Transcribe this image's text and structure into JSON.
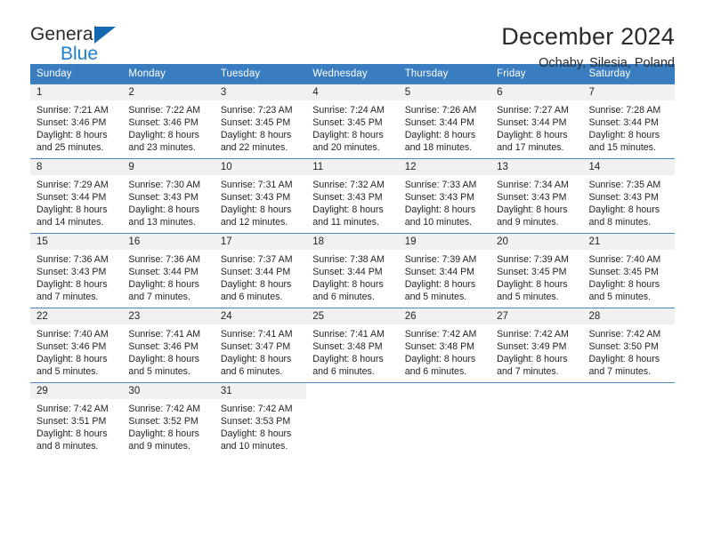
{
  "brand": {
    "name_top": "General",
    "name_bottom": "Blue",
    "accent_color": "#1c7fd0",
    "triangle_color": "#1668b0"
  },
  "header": {
    "title": "December 2024",
    "location": "Ochaby, Silesia, Poland"
  },
  "theme": {
    "header_bg": "#3a7cc0",
    "header_text": "#ffffff",
    "daynum_bg": "#f1f1f1",
    "cell_bg": "#ffffff",
    "row_border": "#4a89c4",
    "text": "#231f20"
  },
  "weekdays": [
    "Sunday",
    "Monday",
    "Tuesday",
    "Wednesday",
    "Thursday",
    "Friday",
    "Saturday"
  ],
  "weeks": [
    [
      {
        "day": "1",
        "sunrise": "Sunrise: 7:21 AM",
        "sunset": "Sunset: 3:46 PM",
        "daylight1": "Daylight: 8 hours",
        "daylight2": "and 25 minutes."
      },
      {
        "day": "2",
        "sunrise": "Sunrise: 7:22 AM",
        "sunset": "Sunset: 3:46 PM",
        "daylight1": "Daylight: 8 hours",
        "daylight2": "and 23 minutes."
      },
      {
        "day": "3",
        "sunrise": "Sunrise: 7:23 AM",
        "sunset": "Sunset: 3:45 PM",
        "daylight1": "Daylight: 8 hours",
        "daylight2": "and 22 minutes."
      },
      {
        "day": "4",
        "sunrise": "Sunrise: 7:24 AM",
        "sunset": "Sunset: 3:45 PM",
        "daylight1": "Daylight: 8 hours",
        "daylight2": "and 20 minutes."
      },
      {
        "day": "5",
        "sunrise": "Sunrise: 7:26 AM",
        "sunset": "Sunset: 3:44 PM",
        "daylight1": "Daylight: 8 hours",
        "daylight2": "and 18 minutes."
      },
      {
        "day": "6",
        "sunrise": "Sunrise: 7:27 AM",
        "sunset": "Sunset: 3:44 PM",
        "daylight1": "Daylight: 8 hours",
        "daylight2": "and 17 minutes."
      },
      {
        "day": "7",
        "sunrise": "Sunrise: 7:28 AM",
        "sunset": "Sunset: 3:44 PM",
        "daylight1": "Daylight: 8 hours",
        "daylight2": "and 15 minutes."
      }
    ],
    [
      {
        "day": "8",
        "sunrise": "Sunrise: 7:29 AM",
        "sunset": "Sunset: 3:44 PM",
        "daylight1": "Daylight: 8 hours",
        "daylight2": "and 14 minutes."
      },
      {
        "day": "9",
        "sunrise": "Sunrise: 7:30 AM",
        "sunset": "Sunset: 3:43 PM",
        "daylight1": "Daylight: 8 hours",
        "daylight2": "and 13 minutes."
      },
      {
        "day": "10",
        "sunrise": "Sunrise: 7:31 AM",
        "sunset": "Sunset: 3:43 PM",
        "daylight1": "Daylight: 8 hours",
        "daylight2": "and 12 minutes."
      },
      {
        "day": "11",
        "sunrise": "Sunrise: 7:32 AM",
        "sunset": "Sunset: 3:43 PM",
        "daylight1": "Daylight: 8 hours",
        "daylight2": "and 11 minutes."
      },
      {
        "day": "12",
        "sunrise": "Sunrise: 7:33 AM",
        "sunset": "Sunset: 3:43 PM",
        "daylight1": "Daylight: 8 hours",
        "daylight2": "and 10 minutes."
      },
      {
        "day": "13",
        "sunrise": "Sunrise: 7:34 AM",
        "sunset": "Sunset: 3:43 PM",
        "daylight1": "Daylight: 8 hours",
        "daylight2": "and 9 minutes."
      },
      {
        "day": "14",
        "sunrise": "Sunrise: 7:35 AM",
        "sunset": "Sunset: 3:43 PM",
        "daylight1": "Daylight: 8 hours",
        "daylight2": "and 8 minutes."
      }
    ],
    [
      {
        "day": "15",
        "sunrise": "Sunrise: 7:36 AM",
        "sunset": "Sunset: 3:43 PM",
        "daylight1": "Daylight: 8 hours",
        "daylight2": "and 7 minutes."
      },
      {
        "day": "16",
        "sunrise": "Sunrise: 7:36 AM",
        "sunset": "Sunset: 3:44 PM",
        "daylight1": "Daylight: 8 hours",
        "daylight2": "and 7 minutes."
      },
      {
        "day": "17",
        "sunrise": "Sunrise: 7:37 AM",
        "sunset": "Sunset: 3:44 PM",
        "daylight1": "Daylight: 8 hours",
        "daylight2": "and 6 minutes."
      },
      {
        "day": "18",
        "sunrise": "Sunrise: 7:38 AM",
        "sunset": "Sunset: 3:44 PM",
        "daylight1": "Daylight: 8 hours",
        "daylight2": "and 6 minutes."
      },
      {
        "day": "19",
        "sunrise": "Sunrise: 7:39 AM",
        "sunset": "Sunset: 3:44 PM",
        "daylight1": "Daylight: 8 hours",
        "daylight2": "and 5 minutes."
      },
      {
        "day": "20",
        "sunrise": "Sunrise: 7:39 AM",
        "sunset": "Sunset: 3:45 PM",
        "daylight1": "Daylight: 8 hours",
        "daylight2": "and 5 minutes."
      },
      {
        "day": "21",
        "sunrise": "Sunrise: 7:40 AM",
        "sunset": "Sunset: 3:45 PM",
        "daylight1": "Daylight: 8 hours",
        "daylight2": "and 5 minutes."
      }
    ],
    [
      {
        "day": "22",
        "sunrise": "Sunrise: 7:40 AM",
        "sunset": "Sunset: 3:46 PM",
        "daylight1": "Daylight: 8 hours",
        "daylight2": "and 5 minutes."
      },
      {
        "day": "23",
        "sunrise": "Sunrise: 7:41 AM",
        "sunset": "Sunset: 3:46 PM",
        "daylight1": "Daylight: 8 hours",
        "daylight2": "and 5 minutes."
      },
      {
        "day": "24",
        "sunrise": "Sunrise: 7:41 AM",
        "sunset": "Sunset: 3:47 PM",
        "daylight1": "Daylight: 8 hours",
        "daylight2": "and 6 minutes."
      },
      {
        "day": "25",
        "sunrise": "Sunrise: 7:41 AM",
        "sunset": "Sunset: 3:48 PM",
        "daylight1": "Daylight: 8 hours",
        "daylight2": "and 6 minutes."
      },
      {
        "day": "26",
        "sunrise": "Sunrise: 7:42 AM",
        "sunset": "Sunset: 3:48 PM",
        "daylight1": "Daylight: 8 hours",
        "daylight2": "and 6 minutes."
      },
      {
        "day": "27",
        "sunrise": "Sunrise: 7:42 AM",
        "sunset": "Sunset: 3:49 PM",
        "daylight1": "Daylight: 8 hours",
        "daylight2": "and 7 minutes."
      },
      {
        "day": "28",
        "sunrise": "Sunrise: 7:42 AM",
        "sunset": "Sunset: 3:50 PM",
        "daylight1": "Daylight: 8 hours",
        "daylight2": "and 7 minutes."
      }
    ],
    [
      {
        "day": "29",
        "sunrise": "Sunrise: 7:42 AM",
        "sunset": "Sunset: 3:51 PM",
        "daylight1": "Daylight: 8 hours",
        "daylight2": "and 8 minutes."
      },
      {
        "day": "30",
        "sunrise": "Sunrise: 7:42 AM",
        "sunset": "Sunset: 3:52 PM",
        "daylight1": "Daylight: 8 hours",
        "daylight2": "and 9 minutes."
      },
      {
        "day": "31",
        "sunrise": "Sunrise: 7:42 AM",
        "sunset": "Sunset: 3:53 PM",
        "daylight1": "Daylight: 8 hours",
        "daylight2": "and 10 minutes."
      },
      {
        "day": "",
        "sunrise": "",
        "sunset": "",
        "daylight1": "",
        "daylight2": ""
      },
      {
        "day": "",
        "sunrise": "",
        "sunset": "",
        "daylight1": "",
        "daylight2": ""
      },
      {
        "day": "",
        "sunrise": "",
        "sunset": "",
        "daylight1": "",
        "daylight2": ""
      },
      {
        "day": "",
        "sunrise": "",
        "sunset": "",
        "daylight1": "",
        "daylight2": ""
      }
    ]
  ]
}
